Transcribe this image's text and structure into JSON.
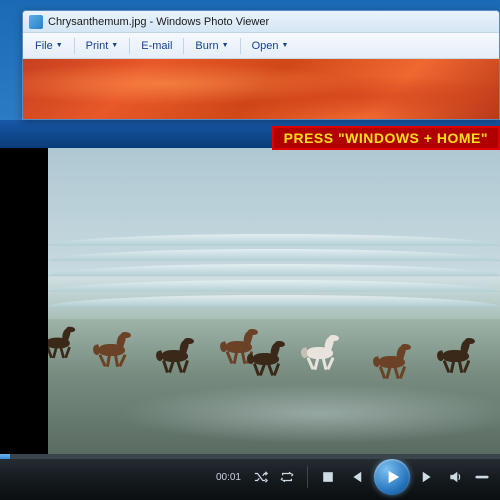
{
  "photo_viewer": {
    "title": "Chrysanthemum.jpg - Windows Photo Viewer",
    "toolbar": {
      "file": "File",
      "print": "Print",
      "email": "E-mail",
      "burn": "Burn",
      "open": "Open"
    }
  },
  "overlay": {
    "instruction": "PRESS \"WINDOWS + HOME\""
  },
  "media_player": {
    "time_elapsed": "00:01",
    "controls": {
      "shuffle": "shuffle",
      "repeat": "repeat",
      "stop": "stop",
      "previous": "previous",
      "play": "play",
      "next": "next",
      "volume": "volume"
    }
  }
}
